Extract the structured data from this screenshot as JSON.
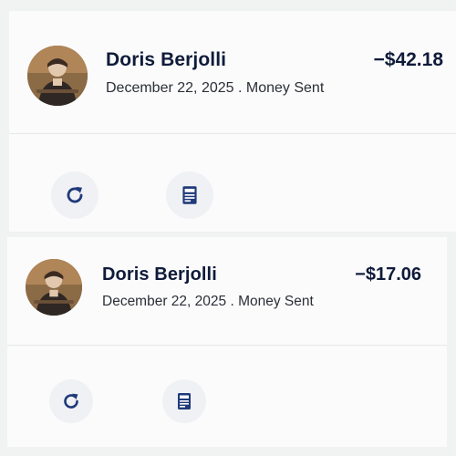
{
  "transactions": [
    {
      "name": "Doris Berjolli",
      "amount": "−$42.18",
      "date": "December 22, 2025",
      "separator": ".",
      "type": "Money Sent",
      "actions": [
        {
          "icon": "refresh-icon",
          "label": "Repeat"
        },
        {
          "icon": "receipt-icon",
          "label": "Receipt"
        }
      ]
    },
    {
      "name": "Doris Berjolli",
      "amount": "−$17.06",
      "date": "December 22, 2025",
      "separator": ".",
      "type": "Money Sent",
      "actions": [
        {
          "icon": "refresh-icon",
          "label": "Repeat"
        },
        {
          "icon": "receipt-icon",
          "label": "Receipt"
        }
      ]
    }
  ],
  "colors": {
    "text_primary": "#0f1b3a",
    "text_secondary": "#2b2f37",
    "icon": "#1f3a7a",
    "card_bg": "#fbfbfb",
    "page_bg": "#f1f2f2"
  }
}
